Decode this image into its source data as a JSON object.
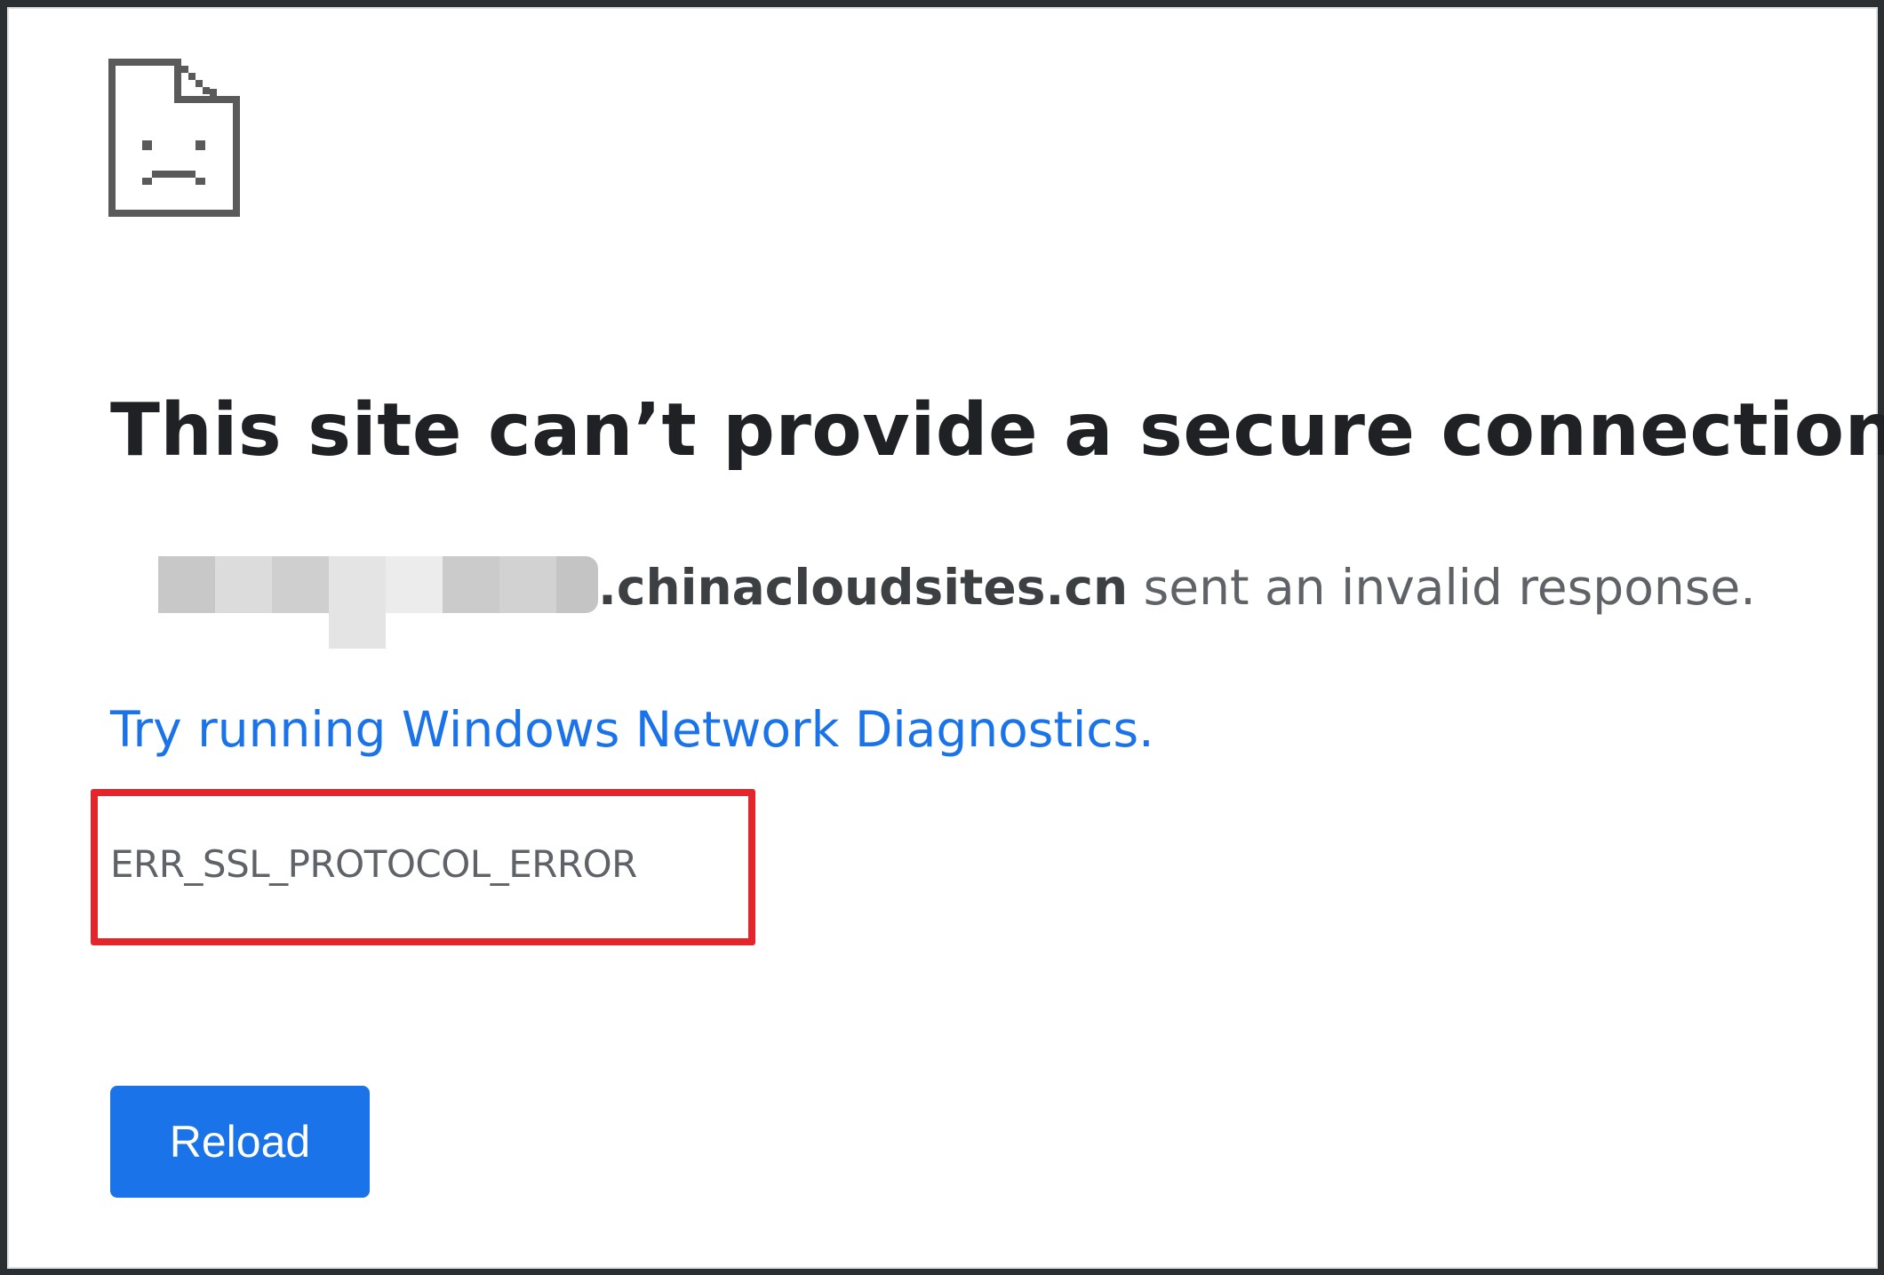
{
  "page": {
    "headline": "This site can’t provide a secure connection",
    "domain_suffix": ".chinacloudsites.cn",
    "response_text": " sent an invalid response.",
    "diagnostics_link": "Try running Windows Network Diagnostics.",
    "error_code": "ERR_SSL_PROTOCOL_ERROR",
    "reload_label": "Reload"
  },
  "icons": {
    "error_icon": "sad-page-icon"
  },
  "colors": {
    "link": "#1a73e8",
    "button_bg": "#1a73e8",
    "highlight_border": "#e3262c",
    "heading_text": "#202124",
    "body_text": "#5f6368"
  }
}
